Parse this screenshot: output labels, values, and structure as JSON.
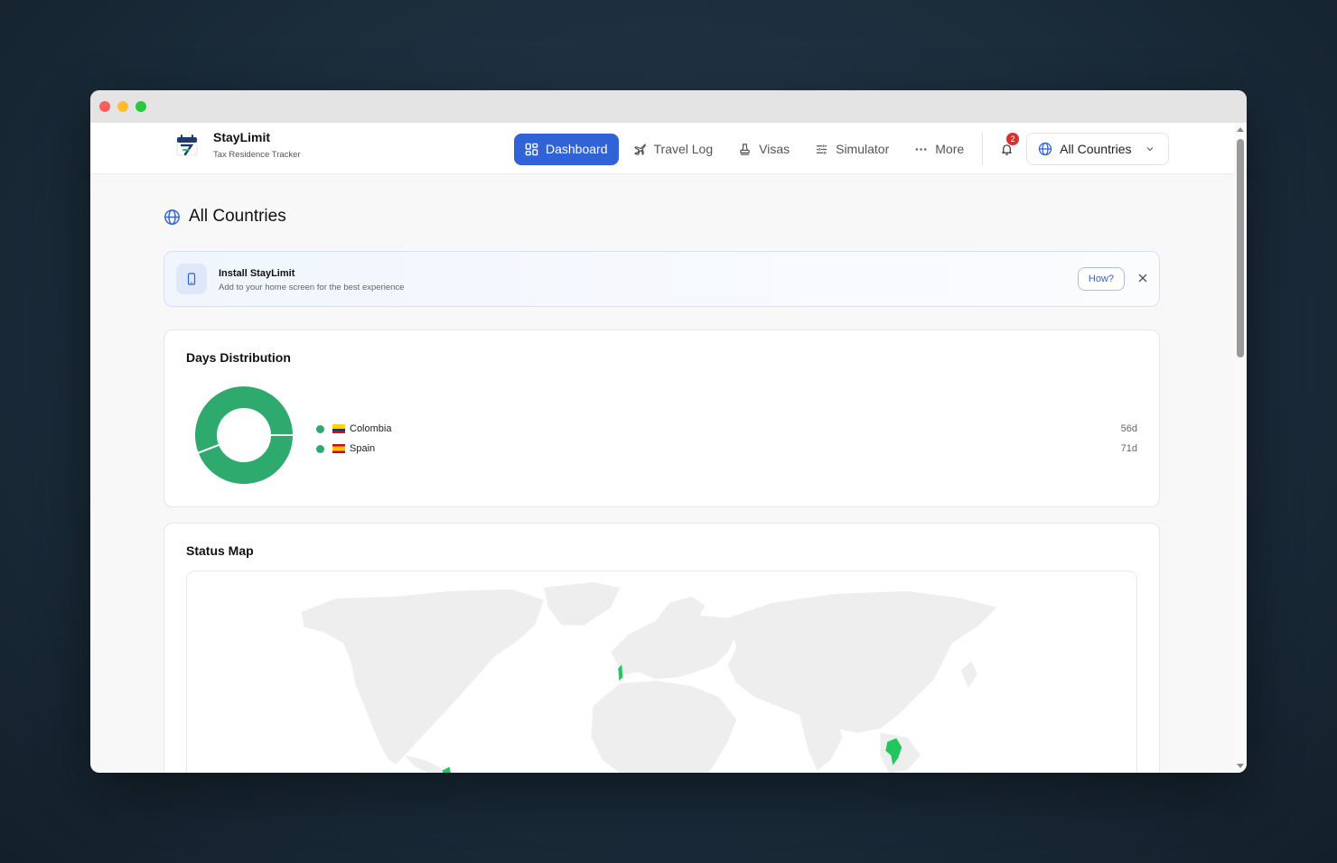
{
  "app": {
    "name": "StayLimit",
    "subtitle": "Tax Residence Tracker"
  },
  "nav": {
    "items": [
      {
        "label": "Dashboard",
        "icon": "dashboard-icon",
        "active": true
      },
      {
        "label": "Travel Log",
        "icon": "plane-icon",
        "active": false
      },
      {
        "label": "Visas",
        "icon": "stamp-icon",
        "active": false
      },
      {
        "label": "Simulator",
        "icon": "sliders-icon",
        "active": false
      },
      {
        "label": "More",
        "icon": "more-icon",
        "active": false
      }
    ],
    "notifications_count": "2",
    "country_selector": "All Countries"
  },
  "page": {
    "title": "All Countries"
  },
  "install_banner": {
    "title": "Install StayLimit",
    "subtitle": "Add to your home screen for the best experience",
    "how_label": "How?"
  },
  "distribution": {
    "title": "Days Distribution",
    "items": [
      {
        "country": "Colombia",
        "value": "56d",
        "days": 56,
        "color": "#2eaa6e"
      },
      {
        "country": "Spain",
        "value": "71d",
        "days": 71,
        "color": "#2eaa6e"
      }
    ]
  },
  "status_map": {
    "title": "Status Map",
    "highlight_color": "#22c55e",
    "land_color": "#eeeeee"
  },
  "colors": {
    "accent": "#2f63d6",
    "donut": "#2eaa6e"
  }
}
